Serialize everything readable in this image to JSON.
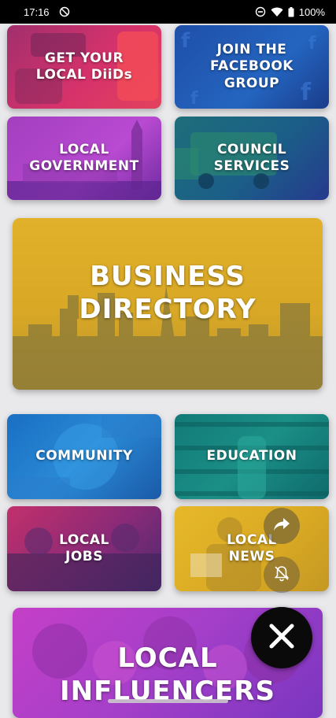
{
  "status_bar": {
    "time": "17:16",
    "battery": "100%"
  },
  "tiles": {
    "diids": "GET YOUR\nLOCAL DiiDs",
    "facebook": "JOIN THE\nFACEBOOK\nGROUP",
    "government": "LOCAL\nGOVERNMENT",
    "council": "COUNCIL\nSERVICES",
    "business": "BUSINESS\nDIRECTORY",
    "community": "COMMUNITY",
    "education": "EDUCATION",
    "jobs": "LOCAL\nJOBS",
    "news": "LOCAL\nNEWS",
    "influencers": "LOCAL\nINFLUENCERS"
  },
  "icons": {
    "share": "share-icon",
    "mute": "bell-off-icon",
    "close": "close-icon"
  }
}
